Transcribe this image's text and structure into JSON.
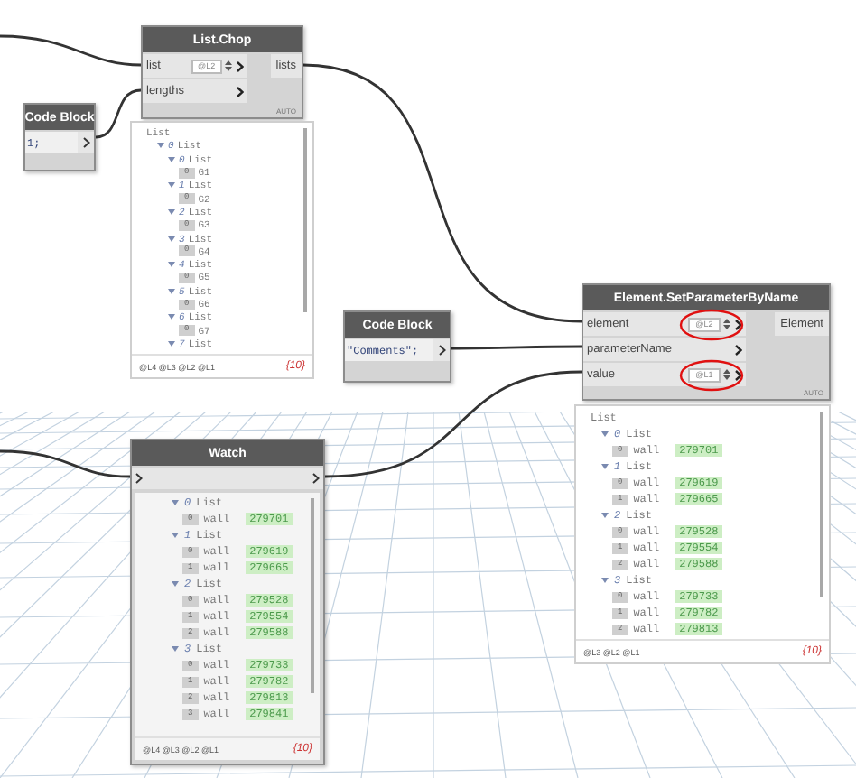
{
  "nodes": [
    {
      "kind": "function",
      "title": "List.Chop",
      "inputs": [
        {
          "name": "list",
          "lacing": "@L2"
        },
        {
          "name": "lengths"
        }
      ],
      "outputs": [
        "lists"
      ],
      "mode": "AUTO",
      "preview": {
        "root": "List",
        "tree": [
          {
            "index": "0",
            "label": "List",
            "children": [
              {
                "index": "0",
                "label": "List",
                "children": [
                  {
                    "kind": "text",
                    "index": "0",
                    "value": "G1"
                  }
                ]
              },
              {
                "index": "1",
                "label": "List",
                "children": [
                  {
                    "kind": "text",
                    "index": "0",
                    "value": "G2"
                  }
                ]
              },
              {
                "index": "2",
                "label": "List",
                "children": [
                  {
                    "kind": "text",
                    "index": "0",
                    "value": "G3"
                  }
                ]
              },
              {
                "index": "3",
                "label": "List",
                "children": [
                  {
                    "kind": "text",
                    "index": "0",
                    "value": "G4"
                  }
                ]
              },
              {
                "index": "4",
                "label": "List",
                "children": [
                  {
                    "kind": "text",
                    "index": "0",
                    "value": "G5"
                  }
                ]
              },
              {
                "index": "5",
                "label": "List",
                "children": [
                  {
                    "kind": "text",
                    "index": "0",
                    "value": "G6"
                  }
                ]
              },
              {
                "index": "6",
                "label": "List",
                "children": [
                  {
                    "kind": "text",
                    "index": "0",
                    "value": "G7"
                  }
                ]
              },
              {
                "index": "7",
                "label": "List"
              }
            ]
          }
        ],
        "levels": "@L4 @L3 @L2 @L1",
        "count": "{10}"
      }
    },
    {
      "kind": "code",
      "title": "Code Block",
      "code": "1;"
    },
    {
      "kind": "code",
      "title": "Code Block",
      "code": "\"Comments\";"
    },
    {
      "kind": "function",
      "title": "Element.SetParameterByName",
      "inputs": [
        {
          "name": "element",
          "lacing": "@L2",
          "circled": true
        },
        {
          "name": "parameterName"
        },
        {
          "name": "value",
          "lacing": "@L1",
          "circled": true
        }
      ],
      "outputs": [
        "Element"
      ],
      "mode": "AUTO",
      "preview": {
        "root": "List",
        "tree": [
          {
            "index": "0",
            "label": "List",
            "children": [
              {
                "kind": "element",
                "index": "0",
                "type": "wall",
                "value": "279701"
              }
            ]
          },
          {
            "index": "1",
            "label": "List",
            "children": [
              {
                "kind": "element",
                "index": "0",
                "type": "wall",
                "value": "279619"
              },
              {
                "kind": "element",
                "index": "1",
                "type": "wall",
                "value": "279665"
              }
            ]
          },
          {
            "index": "2",
            "label": "List",
            "children": [
              {
                "kind": "element",
                "index": "0",
                "type": "wall",
                "value": "279528"
              },
              {
                "kind": "element",
                "index": "1",
                "type": "wall",
                "value": "279554"
              },
              {
                "kind": "element",
                "index": "2",
                "type": "wall",
                "value": "279588"
              }
            ]
          },
          {
            "index": "3",
            "label": "List",
            "children": [
              {
                "kind": "element",
                "index": "0",
                "type": "wall",
                "value": "279733"
              },
              {
                "kind": "element",
                "index": "1",
                "type": "wall",
                "value": "279782"
              },
              {
                "kind": "element",
                "index": "2",
                "type": "wall",
                "value": "279813"
              }
            ]
          }
        ],
        "levels": "@L3 @L2 @L1",
        "count": "{10}"
      }
    },
    {
      "kind": "watch",
      "title": "Watch",
      "preview": {
        "tree": [
          {
            "index": "0",
            "label": "List",
            "children": [
              {
                "kind": "element",
                "index": "0",
                "type": "wall",
                "value": "279701"
              }
            ]
          },
          {
            "index": "1",
            "label": "List",
            "children": [
              {
                "kind": "element",
                "index": "0",
                "type": "wall",
                "value": "279619"
              },
              {
                "kind": "element",
                "index": "1",
                "type": "wall",
                "value": "279665"
              }
            ]
          },
          {
            "index": "2",
            "label": "List",
            "children": [
              {
                "kind": "element",
                "index": "0",
                "type": "wall",
                "value": "279528"
              },
              {
                "kind": "element",
                "index": "1",
                "type": "wall",
                "value": "279554"
              },
              {
                "kind": "element",
                "index": "2",
                "type": "wall",
                "value": "279588"
              }
            ]
          },
          {
            "index": "3",
            "label": "List",
            "children": [
              {
                "kind": "element",
                "index": "0",
                "type": "wall",
                "value": "279733"
              },
              {
                "kind": "element",
                "index": "1",
                "type": "wall",
                "value": "279782"
              },
              {
                "kind": "element",
                "index": "2",
                "type": "wall",
                "value": "279813"
              },
              {
                "kind": "element",
                "index": "3",
                "type": "wall",
                "value": "279841"
              }
            ]
          }
        ],
        "levels": "@L4 @L3 @L2 @L1",
        "count": "{10}"
      }
    }
  ]
}
